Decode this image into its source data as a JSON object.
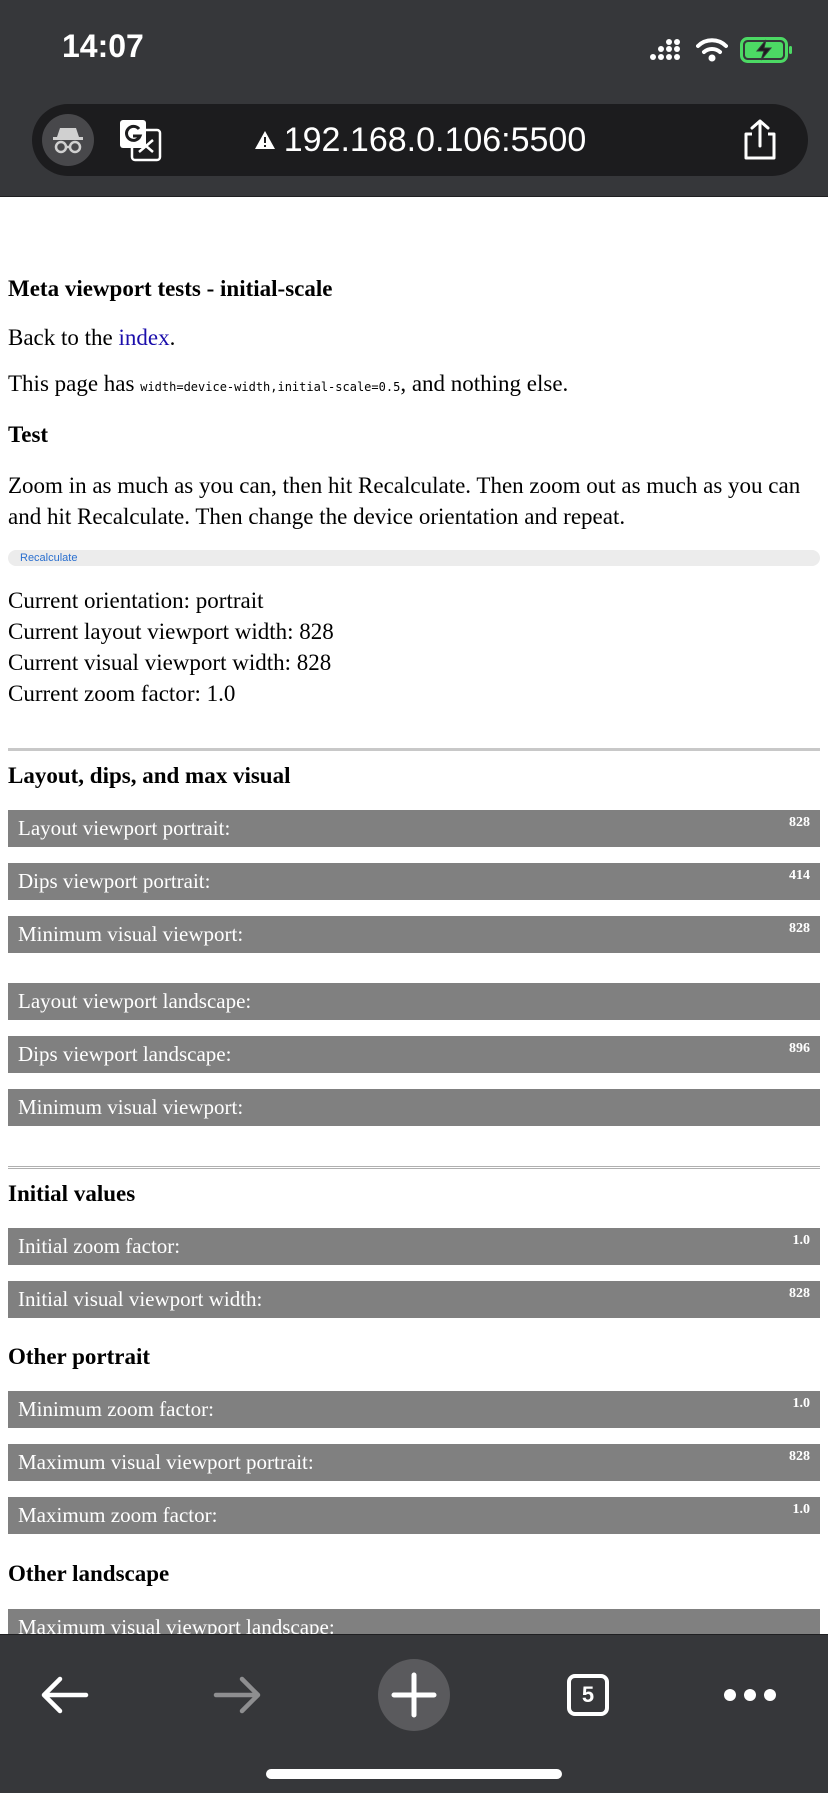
{
  "status": {
    "time": "14:07"
  },
  "browser": {
    "url": "192.168.0.106:5500",
    "tab_count": "5"
  },
  "page": {
    "title": "Meta viewport tests - initial-scale",
    "back_prefix": "Back to the ",
    "back_link": "index",
    "back_suffix": ".",
    "desc_prefix": "This page has ",
    "desc_code": "width=device-width,initial-scale=0.5",
    "desc_suffix": ", and nothing else.",
    "test_heading": "Test",
    "instructions": "Zoom in as much as you can, then hit Recalculate. Then zoom out as much as you can and hit Recalculate. Then change the device orientation and repeat.",
    "recalculate_label": "Recalculate",
    "current": {
      "orientation": "Current orientation: portrait",
      "layout_width": "Current layout viewport width: 828",
      "visual_width": "Current visual viewport width: 828",
      "zoom": "Current zoom factor: 1.0"
    },
    "sections": {
      "layout": {
        "title": "Layout, dips, and max visual",
        "rows": [
          {
            "label": "Layout viewport portrait:",
            "value": "828"
          },
          {
            "label": "Dips viewport portrait:",
            "value": "414"
          },
          {
            "label": "Minimum visual viewport:",
            "value": "828"
          },
          {
            "label": "Layout viewport landscape:",
            "value": ""
          },
          {
            "label": "Dips viewport landscape:",
            "value": "896"
          },
          {
            "label": "Minimum visual viewport:",
            "value": ""
          }
        ]
      },
      "initial": {
        "title": "Initial values",
        "rows": [
          {
            "label": "Initial zoom factor:",
            "value": "1.0"
          },
          {
            "label": "Initial visual viewport width:",
            "value": "828"
          }
        ]
      },
      "portrait": {
        "title": "Other portrait",
        "rows": [
          {
            "label": "Minimum zoom factor:",
            "value": "1.0"
          },
          {
            "label": "Maximum visual viewport portrait:",
            "value": "828"
          },
          {
            "label": "Maximum zoom factor:",
            "value": "1.0"
          }
        ]
      },
      "landscape": {
        "title": "Other landscape",
        "rows": [
          {
            "label": "Maximum visual viewport landscape:",
            "value": ""
          }
        ]
      }
    }
  },
  "icons": {
    "incognito": "incognito-icon",
    "translate": "translate-icon",
    "warning": "warning-icon",
    "share": "share-icon",
    "back": "arrow-left-icon",
    "forward": "arrow-right-icon",
    "new_tab": "plus-icon",
    "tabs": "tabs-icon",
    "more": "more-dots-icon"
  },
  "colors": {
    "chrome_bg": "#36373a",
    "bar_bg": "#808080",
    "link": "#1a0dab",
    "battery": "#4cd964"
  }
}
